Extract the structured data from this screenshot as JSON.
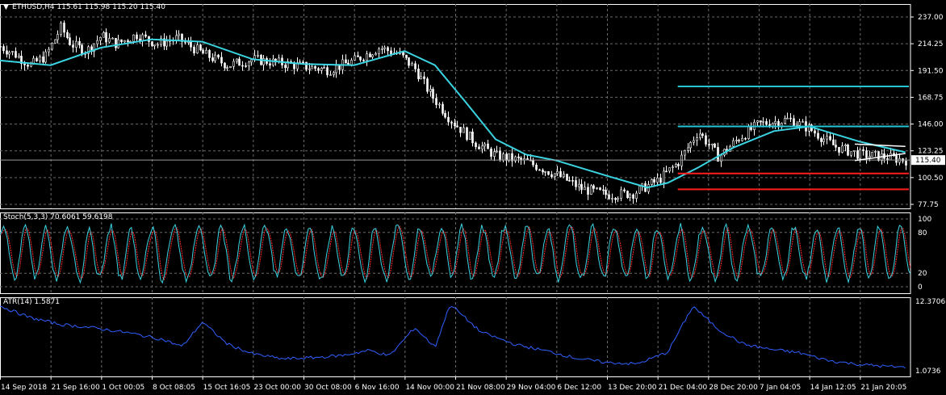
{
  "symbol_header": {
    "arrow": "▼",
    "text": "ETHUSD,H4  115.61 115.98 115.20 115.40"
  },
  "stoch_header": "Stoch(5,3,3) 70.6061 59.6198",
  "atr_header": "ATR(14) 1.5871",
  "colors": {
    "background": "#000000",
    "grid": "#6b6b6b",
    "candles": "#ffffff",
    "moving_average": "#3ad4e2",
    "support_line": "#ff1e1e",
    "resistance_line": "#24c4d4",
    "current_price_line": "#9a9a9a",
    "stoch_main": "#3ad4e2",
    "stoch_signal": "#ff2a2a",
    "atr_line": "#2f5fff",
    "panel_border": "#ffffff"
  },
  "price_label": "115.40",
  "chart_data": [
    {
      "type": "candlestick",
      "title": "ETHUSD,H4",
      "y_ticks": [
        "237.00",
        "214.25",
        "191.50",
        "168.75",
        "146.00",
        "123.25",
        "100.50",
        "77.75"
      ],
      "ylim": [
        77.75,
        237.0
      ],
      "current_price": 115.4,
      "horizontal_lines": [
        {
          "name": "resistance_upper",
          "value": 178.0,
          "color": "#24c4d4",
          "from": "21 Dec 04:00"
        },
        {
          "name": "resistance_lower",
          "value": 144.0,
          "color": "#24c4d4",
          "from": "21 Dec 04:00"
        },
        {
          "name": "support_upper",
          "value": 104.0,
          "color": "#ff1e1e",
          "from": "21 Dec 04:00"
        },
        {
          "name": "support_lower",
          "value": 90.5,
          "color": "#ff1e1e",
          "from": "21 Dec 04:00"
        }
      ],
      "triangle_pattern": {
        "upper": [
          [
            14,
            129
          ],
          [
            21,
            127
          ]
        ],
        "lower": [
          [
            14,
            115
          ],
          [
            21,
            121
          ]
        ]
      },
      "x_labels": [
        "14 Sep 2018",
        "21 Sep 16:00",
        "1 Oct 00:05",
        "8 Oct 08:05",
        "15 Oct 16:05",
        "23 Oct 00:00",
        "30 Oct 08:00",
        "6 Nov 16:00",
        "14 Nov 00:00",
        "21 Nov 08:00",
        "29 Nov 04:00",
        "6 Dec 12:00",
        "13 Dec 20:00",
        "21 Dec 04:00",
        "28 Dec 20:00",
        "7 Jan 04:05",
        "14 Jan 12:05",
        "21 Jan 20:05"
      ],
      "close_path": [
        [
          0,
          212
        ],
        [
          0.3,
          205
        ],
        [
          0.6,
          196
        ],
        [
          0.9,
          204
        ],
        [
          1.2,
          228
        ],
        [
          1.4,
          214
        ],
        [
          1.7,
          208
        ],
        [
          2.0,
          221
        ],
        [
          2.3,
          214
        ],
        [
          2.7,
          222
        ],
        [
          3.1,
          214
        ],
        [
          3.5,
          219
        ],
        [
          4.0,
          206
        ],
        [
          4.5,
          196
        ],
        [
          5.0,
          201
        ],
        [
          5.5,
          198
        ],
        [
          6.0,
          195
        ],
        [
          6.5,
          192
        ],
        [
          7.0,
          200
        ],
        [
          7.5,
          211
        ],
        [
          7.9,
          205
        ],
        [
          8.2,
          193
        ],
        [
          8.5,
          172
        ],
        [
          8.9,
          150
        ],
        [
          9.4,
          130
        ],
        [
          9.8,
          119
        ],
        [
          10.4,
          114
        ],
        [
          11.0,
          103
        ],
        [
          11.5,
          91
        ],
        [
          12.0,
          86
        ],
        [
          12.5,
          87
        ],
        [
          13.0,
          98
        ],
        [
          13.4,
          113
        ],
        [
          13.8,
          140
        ],
        [
          14.2,
          118
        ],
        [
          14.6,
          134
        ],
        [
          15.0,
          146
        ],
        [
          15.6,
          150
        ],
        [
          16.0,
          142
        ],
        [
          16.5,
          127
        ],
        [
          17.0,
          120
        ],
        [
          17.5,
          118
        ],
        [
          17.9,
          115.4
        ]
      ],
      "moving_average_path": [
        [
          0,
          200
        ],
        [
          1,
          196
        ],
        [
          2,
          211
        ],
        [
          3,
          218
        ],
        [
          4,
          216
        ],
        [
          5,
          201
        ],
        [
          6,
          197
        ],
        [
          7,
          196
        ],
        [
          8,
          208
        ],
        [
          8.6,
          196
        ],
        [
          9.2,
          165
        ],
        [
          9.8,
          133
        ],
        [
          10.4,
          120
        ],
        [
          11.0,
          115
        ],
        [
          12.0,
          102
        ],
        [
          12.8,
          92
        ],
        [
          13.2,
          96
        ],
        [
          13.8,
          109
        ],
        [
          14.5,
          126
        ],
        [
          15.3,
          140
        ],
        [
          16.0,
          144
        ],
        [
          17.0,
          131
        ],
        [
          17.9,
          122
        ]
      ]
    },
    {
      "type": "line",
      "title": "Stoch(5,3,3)",
      "y_ticks": [
        "100",
        "80",
        "20",
        "0"
      ],
      "ylim": [
        0,
        100
      ],
      "series": [
        {
          "name": "Main",
          "value": 70.6061
        },
        {
          "name": "Signal",
          "value": 59.6198
        }
      ]
    },
    {
      "type": "line",
      "title": "ATR(14)",
      "y_ticks": [
        "12.3706",
        "1.0736"
      ],
      "ylim": [
        1.0736,
        12.3706
      ],
      "series": [
        {
          "name": "ATR",
          "value": 1.5871,
          "path": [
            [
              0,
              11.6
            ],
            [
              0.6,
              9.7
            ],
            [
              1.2,
              8.6
            ],
            [
              1.8,
              8.1
            ],
            [
              2.5,
              7.3
            ],
            [
              3.2,
              6.2
            ],
            [
              3.6,
              5.0
            ],
            [
              4.0,
              9.0
            ],
            [
              4.5,
              5.4
            ],
            [
              5.0,
              3.8
            ],
            [
              5.6,
              3.0
            ],
            [
              6.2,
              3.2
            ],
            [
              6.8,
              3.6
            ],
            [
              7.3,
              4.4
            ],
            [
              7.7,
              3.5
            ],
            [
              8.2,
              8.1
            ],
            [
              8.6,
              4.9
            ],
            [
              8.9,
              11.9
            ],
            [
              9.5,
              7.4
            ],
            [
              10.2,
              5.3
            ],
            [
              10.8,
              4.3
            ],
            [
              11.4,
              3.1
            ],
            [
              12.0,
              2.4
            ],
            [
              12.6,
              2.2
            ],
            [
              13.2,
              4.1
            ],
            [
              13.7,
              11.6
            ],
            [
              14.2,
              7.8
            ],
            [
              14.7,
              5.4
            ],
            [
              15.2,
              4.6
            ],
            [
              15.8,
              4.0
            ],
            [
              16.4,
              2.7
            ],
            [
              17.0,
              2.1
            ],
            [
              17.5,
              1.8
            ],
            [
              17.9,
              1.6
            ]
          ]
        }
      ]
    }
  ]
}
